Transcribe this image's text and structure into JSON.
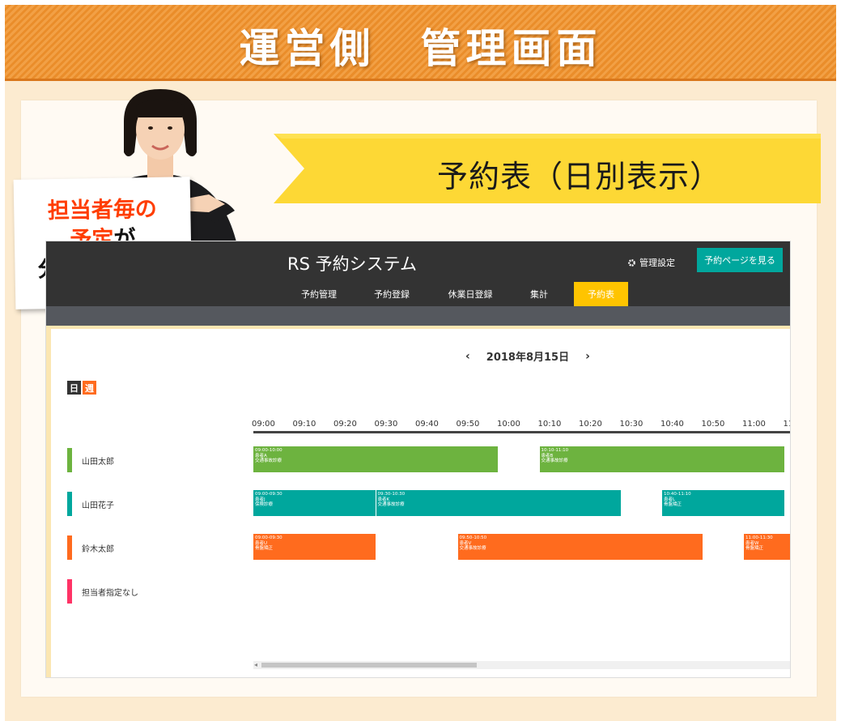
{
  "banner": {
    "title": "運営側　管理画面"
  },
  "ribbon": {
    "text": "予約表（日別表示）"
  },
  "sign": {
    "line1": "担当者毎の",
    "line2_red": "予定",
    "line2_black": "が",
    "line3": "分かりやすい"
  },
  "app": {
    "title": "RS 予約システム",
    "settings_label": "管理設定",
    "view_page_button": "予約ページを見る",
    "nav": [
      {
        "label": "予約管理",
        "active": false
      },
      {
        "label": "予約登録",
        "active": false
      },
      {
        "label": "休業日登録",
        "active": false
      },
      {
        "label": "集計",
        "active": false
      },
      {
        "label": "予約表",
        "active": true
      }
    ],
    "date": "2018年8月15日",
    "prev_arrow": "‹",
    "next_arrow": "›",
    "toggle_day": "日",
    "toggle_week": "週",
    "time_ticks": [
      "09:00",
      "09:10",
      "09:20",
      "09:30",
      "09:40",
      "09:50",
      "10:00",
      "10:10",
      "10:20",
      "10:30",
      "10:40",
      "10:50",
      "11:00",
      "11"
    ],
    "staff": [
      {
        "name": "山田太郎",
        "color": "#6db33f"
      },
      {
        "name": "山田花子",
        "color": "#00a79d"
      },
      {
        "name": "鈴木太郎",
        "color": "#ff6b1e"
      },
      {
        "name": "担当者指定なし",
        "color": "#ff3366"
      }
    ],
    "events": [
      {
        "row": 0,
        "start": "09:00",
        "end": "10:00",
        "time": "09:00-10:00",
        "patient": "患者A",
        "menu": "交通事故診療",
        "color": "#6db33f"
      },
      {
        "row": 0,
        "start": "10:10",
        "end": "11:10",
        "time": "10:10-11:10",
        "patient": "患者B",
        "menu": "交通事故診療",
        "color": "#6db33f"
      },
      {
        "row": 1,
        "start": "09:00",
        "end": "09:30",
        "time": "09:00-09:30",
        "patient": "患者J",
        "menu": "保険診療",
        "color": "#00a79d"
      },
      {
        "row": 1,
        "start": "09:30",
        "end": "10:30",
        "time": "09:30-10:30",
        "patient": "患者K",
        "menu": "交通事故診療",
        "color": "#00a79d"
      },
      {
        "row": 1,
        "start": "10:40",
        "end": "11:10",
        "time": "10:40-11:10",
        "patient": "患者L",
        "menu": "骨盤矯正",
        "color": "#00a79d"
      },
      {
        "row": 2,
        "start": "09:00",
        "end": "09:30",
        "time": "09:00-09:30",
        "patient": "患者U",
        "menu": "骨盤矯正",
        "color": "#ff6b1e"
      },
      {
        "row": 2,
        "start": "09:50",
        "end": "10:50",
        "time": "09:50-10:50",
        "patient": "患者V",
        "menu": "交通事故診療",
        "color": "#ff6b1e"
      },
      {
        "row": 2,
        "start": "11:00",
        "end": "11:30",
        "time": "11:00-11:30",
        "patient": "患者W",
        "menu": "骨盤矯正",
        "color": "#ff6b1e"
      }
    ]
  }
}
